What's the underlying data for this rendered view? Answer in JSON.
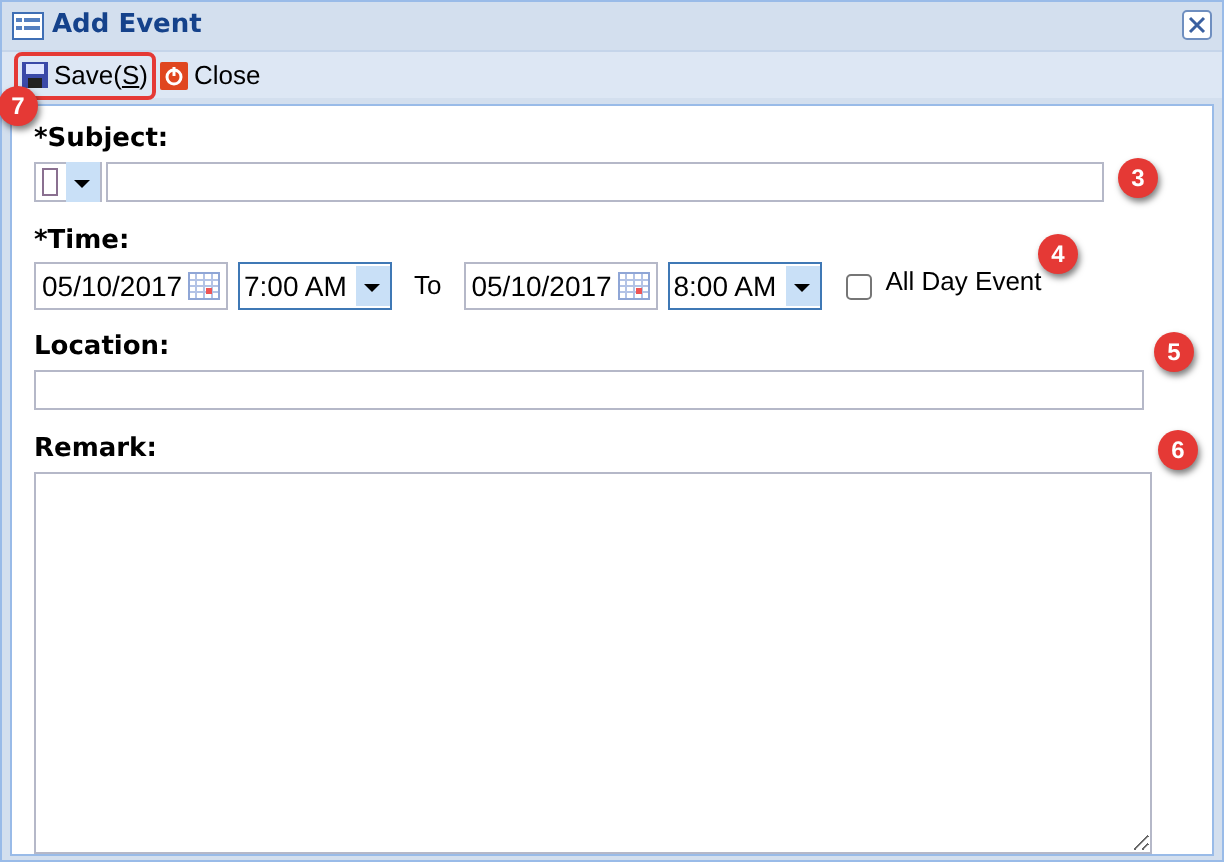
{
  "window": {
    "title": "Add Event"
  },
  "toolbar": [
    {
      "kind": "save",
      "label_parts": [
        "Save(",
        "S",
        ")"
      ],
      "highlighted": true,
      "callout": "7"
    },
    {
      "kind": "close",
      "label": "Close",
      "highlighted": false
    }
  ],
  "subject": {
    "label": "*Subject:",
    "callout": "3"
  },
  "time": {
    "label": "*Time:",
    "start_date": "05/10/2017",
    "start_time": "7:00 AM",
    "separator": "To",
    "end_date": "05/10/2017",
    "end_time": "8:00 AM",
    "all_day": {
      "label": "All Day Event",
      "checked": false
    },
    "callout": "4"
  },
  "location": {
    "label": "Location:",
    "callout": "5"
  },
  "remark": {
    "label": "Remark:",
    "callout": "6"
  }
}
